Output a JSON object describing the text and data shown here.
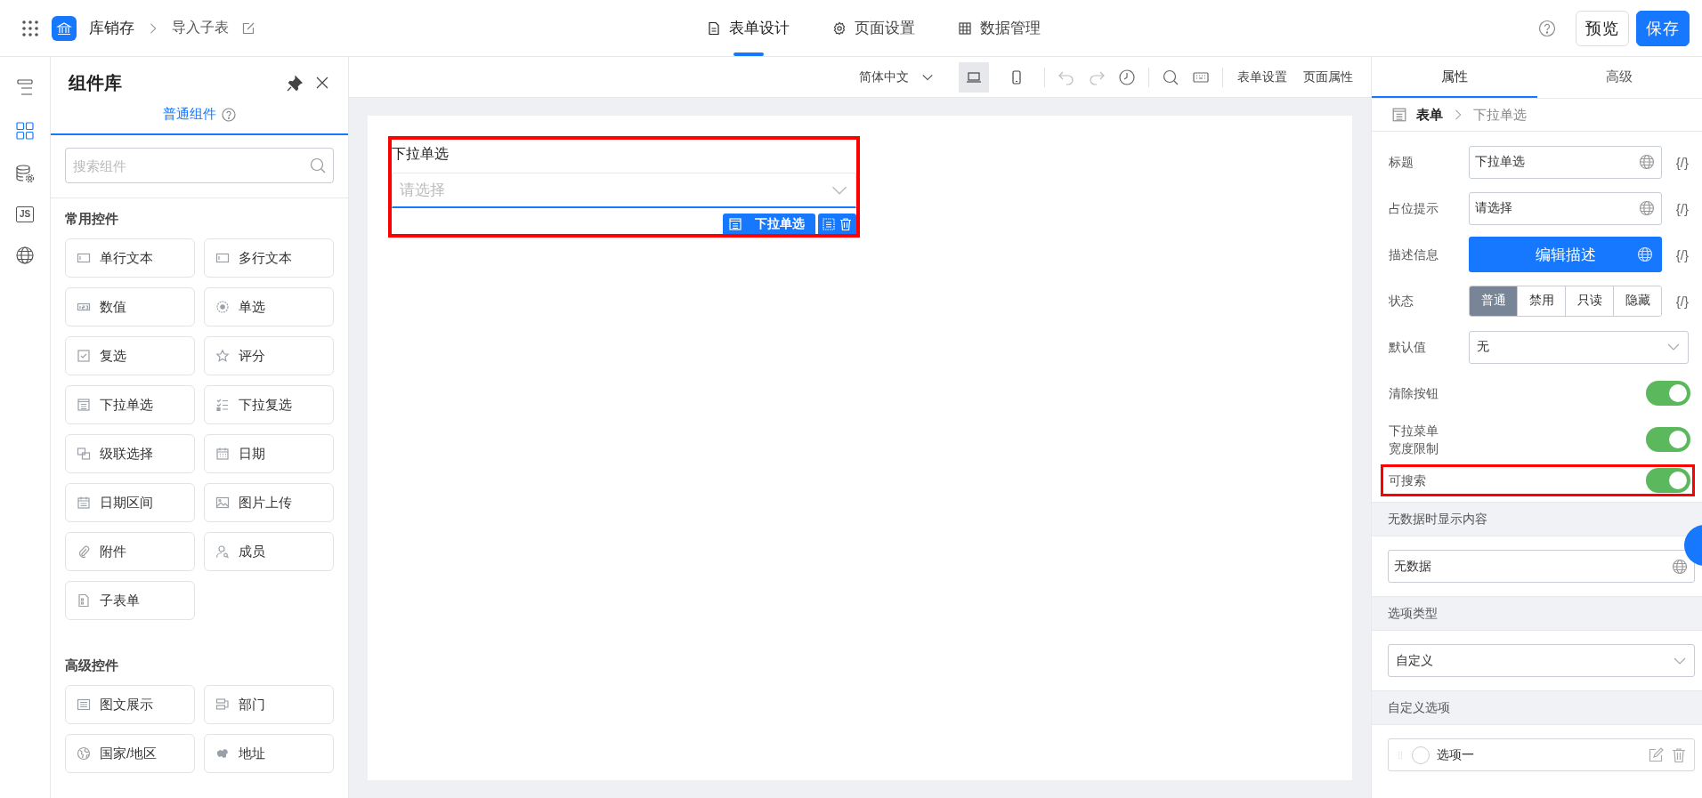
{
  "app": {
    "title": "库销存",
    "page": "导入子表"
  },
  "main_tabs": [
    {
      "label": "表单设计",
      "selected": true
    },
    {
      "label": "页面设置",
      "selected": false
    },
    {
      "label": "数据管理",
      "selected": false
    }
  ],
  "header_buttons": [
    {
      "label": "预览",
      "kind": "secondary"
    },
    {
      "label": "保存",
      "kind": "primary"
    }
  ],
  "rail": [
    {
      "kind": "outline",
      "selected": false
    },
    {
      "kind": "components",
      "selected": true
    },
    {
      "kind": "database",
      "selected": false
    },
    {
      "kind": "js",
      "label": "JS",
      "selected": false
    },
    {
      "kind": "globe",
      "selected": false
    }
  ],
  "library": {
    "title": "组件库",
    "tab": "普通组件",
    "search_placeholder": "搜索组件",
    "groups": [
      {
        "title": "常用控件",
        "items": [
          {
            "label": "单行文本"
          },
          {
            "label": "多行文本"
          },
          {
            "label": "数值"
          },
          {
            "label": "单选"
          },
          {
            "label": "复选"
          },
          {
            "label": "评分"
          },
          {
            "label": "下拉单选"
          },
          {
            "label": "下拉复选"
          },
          {
            "label": "级联选择"
          },
          {
            "label": "日期"
          },
          {
            "label": "日期区间"
          },
          {
            "label": "图片上传"
          },
          {
            "label": "附件"
          },
          {
            "label": "成员"
          },
          {
            "label": "子表单"
          }
        ]
      },
      {
        "title": "高级控件",
        "items": [
          {
            "label": "图文展示"
          },
          {
            "label": "部门"
          },
          {
            "label": "国家/地区"
          },
          {
            "label": "地址"
          }
        ]
      }
    ]
  },
  "toolbar": {
    "language": "简体中文",
    "devices": [
      {
        "kind": "desktop",
        "selected": true
      },
      {
        "kind": "mobile",
        "selected": false
      }
    ],
    "links": [
      "表单设置",
      "页面属性"
    ]
  },
  "form": {
    "field_label": "下拉单选",
    "placeholder": "请选择",
    "badge": "下拉单选",
    "highlighted": true
  },
  "properties": {
    "tabs": [
      {
        "label": "属性",
        "selected": true
      },
      {
        "label": "高级",
        "selected": false
      }
    ],
    "breadcrumb": [
      "表单",
      "下拉单选"
    ],
    "rows": [
      {
        "kind": "input",
        "label": "标题",
        "value": "下拉单选",
        "code": "{/}"
      },
      {
        "kind": "input",
        "label": "占位提示",
        "value": "请选择",
        "code": "{/}"
      },
      {
        "kind": "button",
        "label": "描述信息",
        "value": "编辑描述",
        "code": "{/}"
      },
      {
        "kind": "segmented",
        "label": "状态",
        "options": [
          {
            "label": "普通",
            "selected": true
          },
          {
            "label": "禁用",
            "selected": false
          },
          {
            "label": "只读",
            "selected": false
          },
          {
            "label": "隐藏",
            "selected": false
          }
        ],
        "code": "{/}"
      },
      {
        "kind": "select",
        "label": "默认值",
        "value": "无"
      },
      {
        "kind": "switch",
        "label": "清除按钮",
        "on": true,
        "highlighted": false
      },
      {
        "kind": "switch",
        "label": "下拉菜单宽度限制",
        "on": true,
        "highlighted": false
      },
      {
        "kind": "switch",
        "label": "可搜索",
        "on": true,
        "highlighted": true
      }
    ],
    "sections": [
      {
        "title": "无数据时显示内容",
        "kind": "input",
        "value": "无数据"
      },
      {
        "title": "选项类型",
        "kind": "select",
        "value": "自定义"
      },
      {
        "title": "自定义选项",
        "kind": "options",
        "options": [
          {
            "label": "选项一"
          }
        ]
      }
    ]
  }
}
